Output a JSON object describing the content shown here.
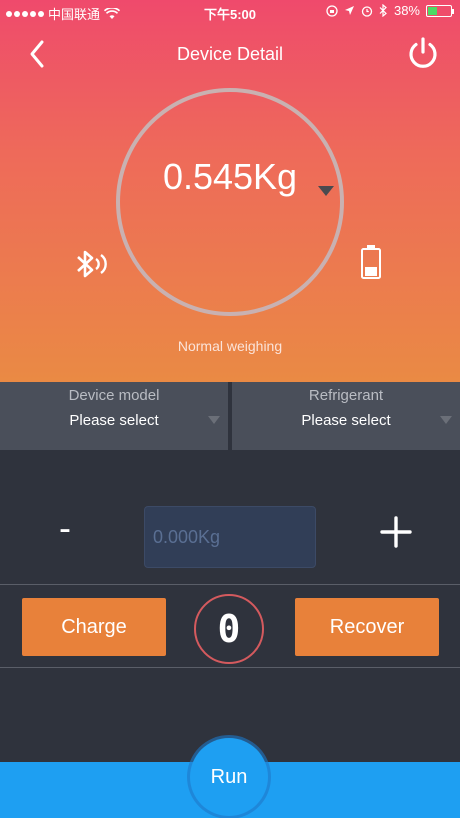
{
  "status_bar": {
    "carrier": "中国联通",
    "time": "下午5:00",
    "battery_percent": "38%",
    "battery_level": 0.38,
    "icons": [
      "signal-dots-icon",
      "wifi-icon",
      "rotation-lock-icon",
      "location-icon",
      "alarm-icon",
      "bluetooth-icon",
      "battery-icon"
    ]
  },
  "nav": {
    "title": "Device Detail",
    "back_icon": "chevron-left-icon",
    "power_icon": "power-icon"
  },
  "gauge": {
    "weight": "0.545Kg",
    "mode": "Normal weighing",
    "bluetooth_icon": "bluetooth-signal-icon",
    "device_battery_icon": "battery-icon",
    "device_battery_level": 0.35
  },
  "selectors": {
    "device_model": {
      "label": "Device model",
      "value": "Please select"
    },
    "refrigerant": {
      "label": "Refrigerant",
      "value": "Please select"
    }
  },
  "adjust": {
    "minus_label": "-",
    "input_placeholder": "0.000Kg",
    "plus_icon": "plus-icon"
  },
  "actions": {
    "charge_label": "Charge",
    "counter_value": "0",
    "recover_label": "Recover"
  },
  "run": {
    "label": "Run"
  },
  "colors": {
    "hero_top": "#ef4a6c",
    "hero_bottom": "#ea8a44",
    "panel_bg": "#2f333d",
    "selector_bg": "#4a4f5a",
    "action_orange": "#e8813a",
    "run_blue": "#1e9ff2"
  }
}
